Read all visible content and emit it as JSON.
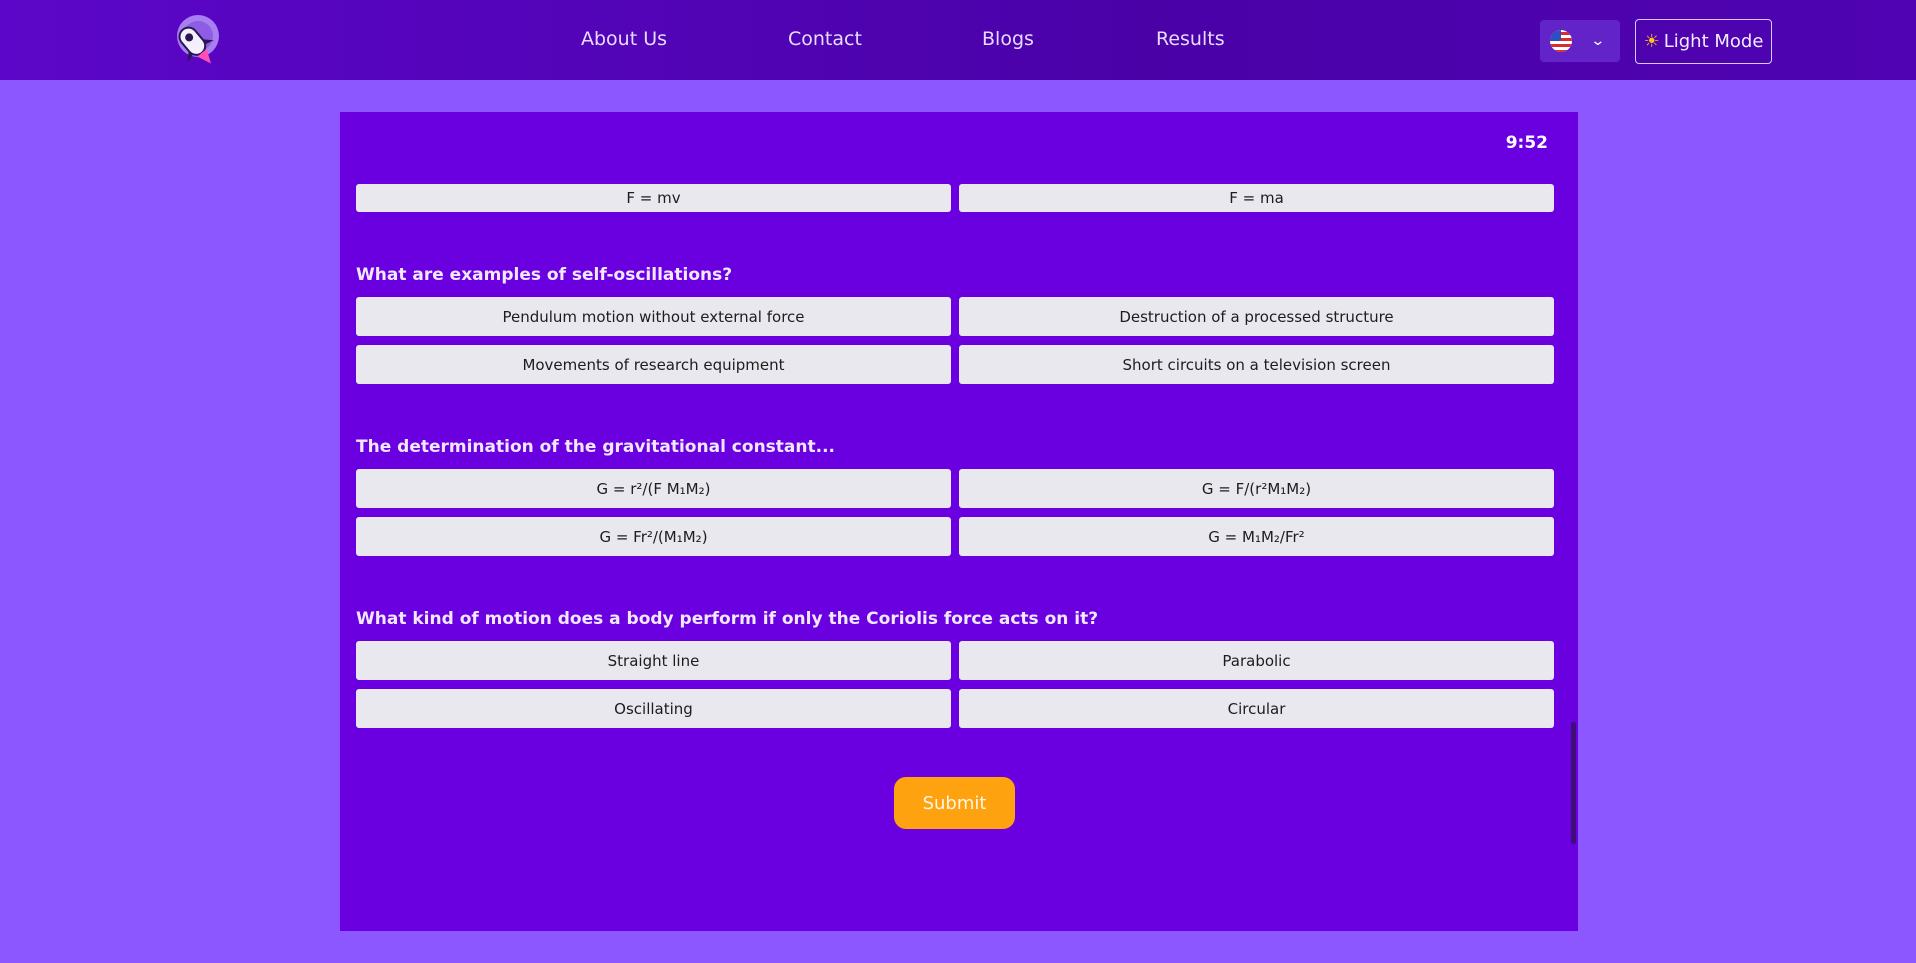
{
  "nav": {
    "links": [
      "About Us",
      "Contact",
      "Blogs",
      "Results"
    ],
    "language_icon": "us-flag-icon",
    "theme_icon": "sun-icon",
    "theme_label": "Light Mode"
  },
  "quiz": {
    "timer": "9:52",
    "partial_options": [
      "F = mv",
      "F = ma"
    ],
    "questions": [
      {
        "text": "What are examples of self-oscillations?",
        "options": [
          "Pendulum motion without external force",
          "Destruction of a processed structure",
          "Movements of research equipment",
          "Short circuits on a television screen"
        ]
      },
      {
        "text": "The determination of the gravitational constant...",
        "options": [
          "G = r²/(F M₁M₂)",
          "G = F/(r²M₁M₂)",
          "G = Fr²/(M₁M₂)",
          "G = M₁M₂/Fr²"
        ]
      },
      {
        "text": "What kind of motion does a body perform if only the Coriolis force acts on it?",
        "options": [
          "Straight line",
          "Parabolic",
          "Oscillating",
          "Circular"
        ]
      }
    ],
    "submit_label": "Submit"
  },
  "colors": {
    "page_bg": "#8c57ff",
    "navbar": "#5405bc",
    "panel": "#6a00e0",
    "option_bg": "#e9e8ee",
    "submit": "#ffa20f"
  }
}
